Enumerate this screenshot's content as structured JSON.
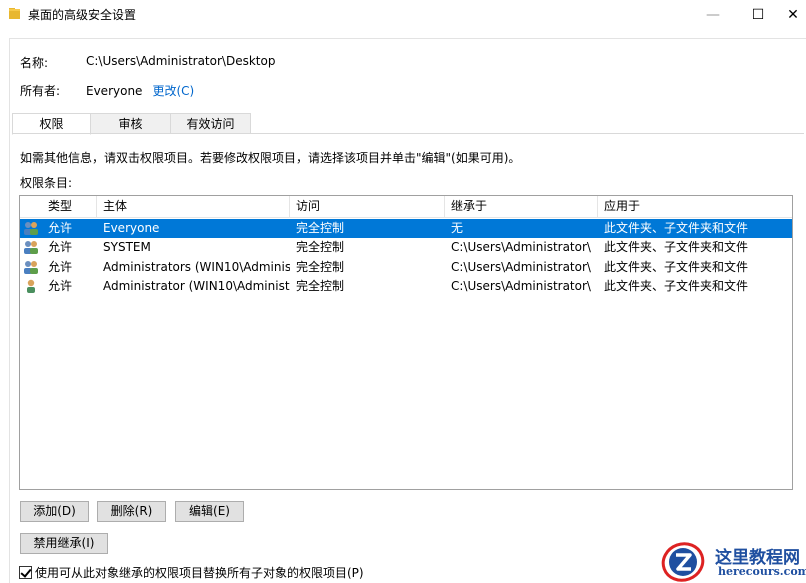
{
  "window": {
    "title": "桌面的高级安全设置",
    "minimize_glyph": "—",
    "maximize_glyph": "☐",
    "close_glyph": "✕"
  },
  "info": {
    "name_label": "名称:",
    "name_value": "C:\\Users\\Administrator\\Desktop",
    "owner_label": "所有者:",
    "owner_value": "Everyone",
    "change_link": "更改(C)"
  },
  "tabs": [
    {
      "label": "权限",
      "active": true
    },
    {
      "label": "审核",
      "active": false
    },
    {
      "label": "有效访问",
      "active": false
    }
  ],
  "help_text": "如需其他信息，请双击权限项目。若要修改权限项目，请选择该项目并单击\"编辑\"(如果可用)。",
  "permission_entries_label": "权限条目:",
  "table": {
    "columns": [
      "类型",
      "主体",
      "访问",
      "继承于",
      "应用于"
    ],
    "rows": [
      {
        "icon": "group-users-icon",
        "type": "允许",
        "principal": "Everyone",
        "access": "完全控制",
        "inherited_from": "无",
        "applies_to": "此文件夹、子文件夹和文件",
        "selected": true
      },
      {
        "icon": "group-users-icon",
        "type": "允许",
        "principal": "SYSTEM",
        "access": "完全控制",
        "inherited_from": "C:\\Users\\Administrator\\",
        "applies_to": "此文件夹、子文件夹和文件",
        "selected": false
      },
      {
        "icon": "group-users-icon",
        "type": "允许",
        "principal": "Administrators (WIN10\\Administ...",
        "access": "完全控制",
        "inherited_from": "C:\\Users\\Administrator\\",
        "applies_to": "此文件夹、子文件夹和文件",
        "selected": false
      },
      {
        "icon": "single-user-icon",
        "type": "允许",
        "principal": "Administrator (WIN10\\Administr...",
        "access": "完全控制",
        "inherited_from": "C:\\Users\\Administrator\\",
        "applies_to": "此文件夹、子文件夹和文件",
        "selected": false
      }
    ]
  },
  "buttons": {
    "add": "添加(D)",
    "remove": "删除(R)",
    "edit": "编辑(E)",
    "disable_inheritance": "禁用继承(I)"
  },
  "replace_checkbox": {
    "label": "使用可从此对象继承的权限项目替换所有子对象的权限项目(P)",
    "checked": true
  },
  "watermark": {
    "title": "这里教程网",
    "url": "herecours.com"
  },
  "colors": {
    "selection": "#0078d7",
    "link": "#0066cc",
    "watermark": "#1f4fa0",
    "folder": "#e8b730"
  }
}
